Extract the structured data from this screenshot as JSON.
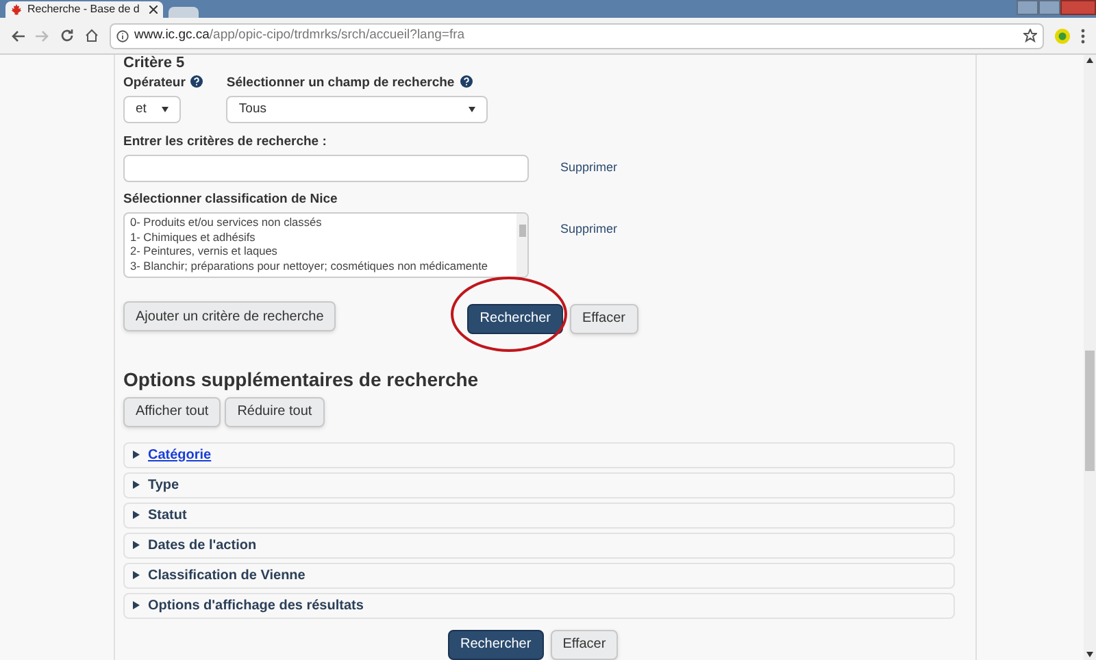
{
  "browser": {
    "tab_title": "Recherche - Base de d",
    "url_host": "www.ic.gc.ca",
    "url_path": "/app/opic-cipo/trdmrks/srch/accueil?lang=fra"
  },
  "criterion": {
    "title": "Critère 5",
    "operator_label": "Opérateur",
    "operator_value": "et",
    "field_label": "Sélectionner un champ de recherche",
    "field_value": "Tous",
    "terms_label": "Entrer les critères de recherche :",
    "terms_remove": "Supprimer",
    "nice_label": "Sélectionner classification de Nice",
    "nice_remove": "Supprimer",
    "nice_options": [
      "0- Produits et/ou services non classés",
      "1- Chimiques et adhésifs",
      "2- Peintures, vernis et laques",
      "3- Blanchir; préparations pour nettoyer; cosmétiques non médicamente"
    ]
  },
  "add_button": "Ajouter un critère de recherche",
  "search_button": "Rechercher",
  "clear_button": "Effacer",
  "search_highlighted": true,
  "options": {
    "title": "Options supplémentaires de recherche",
    "expand_all": "Afficher tout",
    "collapse_all": "Réduire tout",
    "sections": [
      {
        "label": "Catégorie",
        "focused": true
      },
      {
        "label": "Type",
        "focused": false
      },
      {
        "label": "Statut",
        "focused": false
      },
      {
        "label": "Dates de l'action",
        "focused": false
      },
      {
        "label": "Classification de Vienne",
        "focused": false
      },
      {
        "label": "Options d'affichage des résultats",
        "focused": false
      }
    ]
  },
  "bottom_search_button": "Rechercher",
  "bottom_clear_button": "Effacer"
}
